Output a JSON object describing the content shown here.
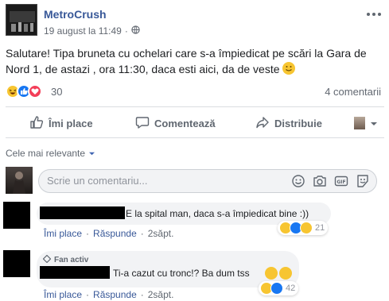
{
  "post": {
    "page_name": "MetroCrush",
    "timestamp": "19 august la 11:49",
    "separator": "·",
    "text": "Salutare! Tipa bruneta cu ochelari care s-a împiedicat pe scări la Gara de Nord 1, de astazi , ora 11:30, daca esti aici, da de veste",
    "reaction_count": "30",
    "comment_count": "4 comentarii"
  },
  "actions": {
    "like": "Îmi place",
    "comment": "Comentează",
    "share": "Distribuie"
  },
  "comments_section": {
    "sort_label": "Cele mai relevante",
    "composer_placeholder": "Scrie un comentariu..."
  },
  "comments": [
    {
      "text": "E la spital man, daca s-a împiedicat bine :))",
      "like": "Îmi place",
      "reply": "Răspunde",
      "age": "2săpt.",
      "reactions": "21"
    },
    {
      "badge": "Fan activ",
      "text": "Ti-a cazut cu tronc!? Ba dum tss",
      "like": "Îmi place",
      "reply": "Răspunde",
      "age": "2săpt.",
      "reactions": "42"
    }
  ],
  "colors": {
    "link_blue": "#385898",
    "like_blue": "#1877f2",
    "love_red": "#f33e58",
    "haha_yellow": "#f7c531",
    "muted": "#606770",
    "bubble_bg": "#f2f3f5"
  },
  "icons": [
    "more-horizontal-icon",
    "globe-icon",
    "haha-reaction-icon",
    "like-reaction-icon",
    "love-reaction-icon",
    "thumbs-up-icon",
    "comment-icon",
    "share-icon",
    "caret-down-icon",
    "smiley-icon",
    "camera-icon",
    "gif-icon",
    "sticker-icon",
    "fan-badge-icon",
    "sad-reaction-icon"
  ]
}
